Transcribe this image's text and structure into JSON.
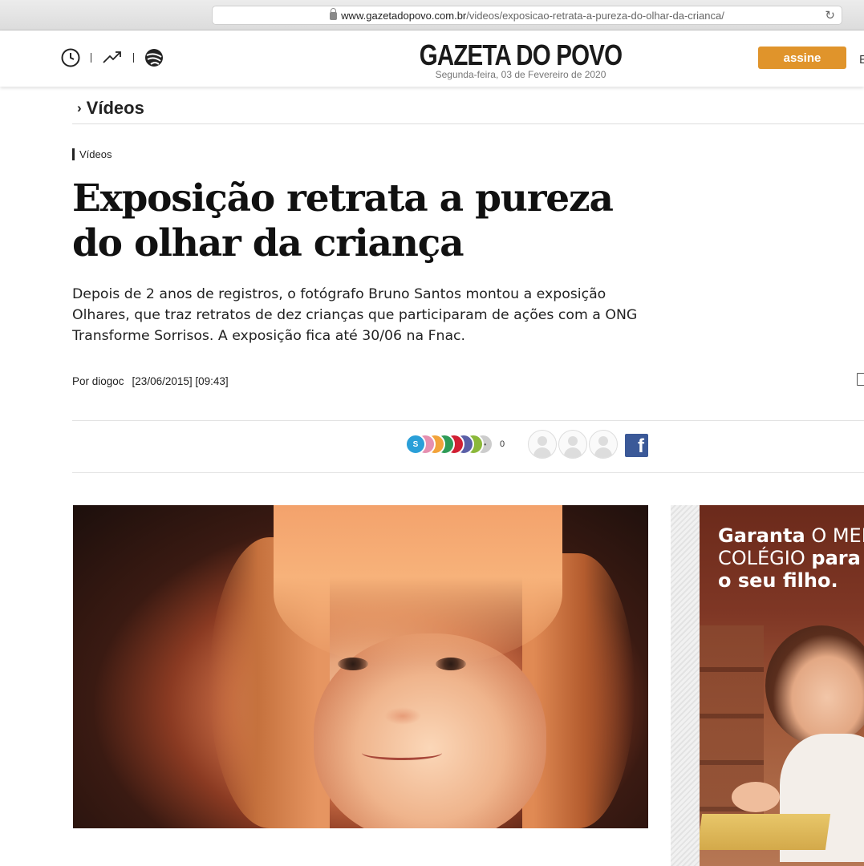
{
  "browser": {
    "url_domain": "www.gazetadopovo.com.br",
    "url_path": "/videos/exposicao-retrata-a-pureza-do-olhar-da-crianca/"
  },
  "header": {
    "logo": "GAZETA DO POVO",
    "date": "Segunda-feira, 03 de Fevereiro de 2020",
    "subscribe_label": "assine",
    "cut_text": "E",
    "icons": [
      "clock-icon",
      "trending-icon",
      "globe-icon"
    ]
  },
  "section": {
    "title": "Vídeos"
  },
  "article": {
    "tag": "Vídeos",
    "headline": "Exposição retrata a pureza do olhar da criança",
    "summary": "Depois de 2 anos de registros, o fotógrafo Bruno Santos montou a exposição Olhares, que traz retratos de dez crianças que participaram de ações com a ONG Transforme Sorrisos. A exposição fica até 30/06 na Fnac.",
    "author": "Por diogoc",
    "datetime": "[23/06/2015] [09:43]"
  },
  "share": {
    "first_icon_letter": "S",
    "more_label": "•••",
    "count": "0",
    "dot_colors": [
      "#2a9fd8",
      "#e58fb0",
      "#f2a33a",
      "#2e9b57",
      "#d11f33",
      "#5a5fa7",
      "#8bb83a",
      "#cccccc"
    ],
    "facebook_label": "f"
  },
  "ad": {
    "line1_bold": "Garanta",
    "line1_rest": " O MELHOR",
    "line2_light": "COLÉGIO ",
    "line2_bold": "para",
    "line3_bold": "o seu filho."
  }
}
